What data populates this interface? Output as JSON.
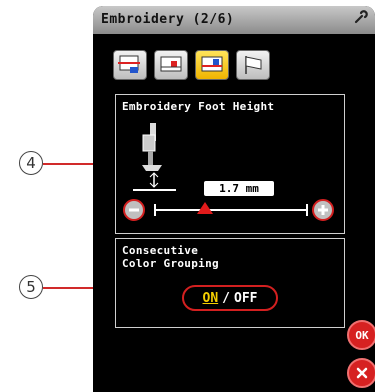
{
  "window": {
    "title": "Embroidery (2/6)",
    "tool_icon": "wrench-icon"
  },
  "tabs": [
    {
      "icon": "embroidery-setting-icon-1",
      "active": false
    },
    {
      "icon": "embroidery-setting-icon-2",
      "active": false
    },
    {
      "icon": "embroidery-setting-icon-3",
      "active": true
    },
    {
      "icon": "flag-icon",
      "active": false
    }
  ],
  "foot_height": {
    "title": "Embroidery Foot Height",
    "value": "1.7 mm",
    "minus_icon": "minus-icon",
    "plus_icon": "plus-icon",
    "slider_level": 0.33
  },
  "color_grouping": {
    "title_line1": "Consecutive",
    "title_line2": "Color Grouping",
    "on_label": "ON",
    "separator": "/",
    "off_label": "OFF"
  },
  "actions": {
    "ok_label": "OK",
    "close_icon": "close-icon"
  },
  "callouts": {
    "foot_height_ref": "4",
    "grouping_ref": "5"
  },
  "colors": {
    "accent_red": "#d32020",
    "active_tab": "#f0b400",
    "on_text": "#f6d000"
  }
}
